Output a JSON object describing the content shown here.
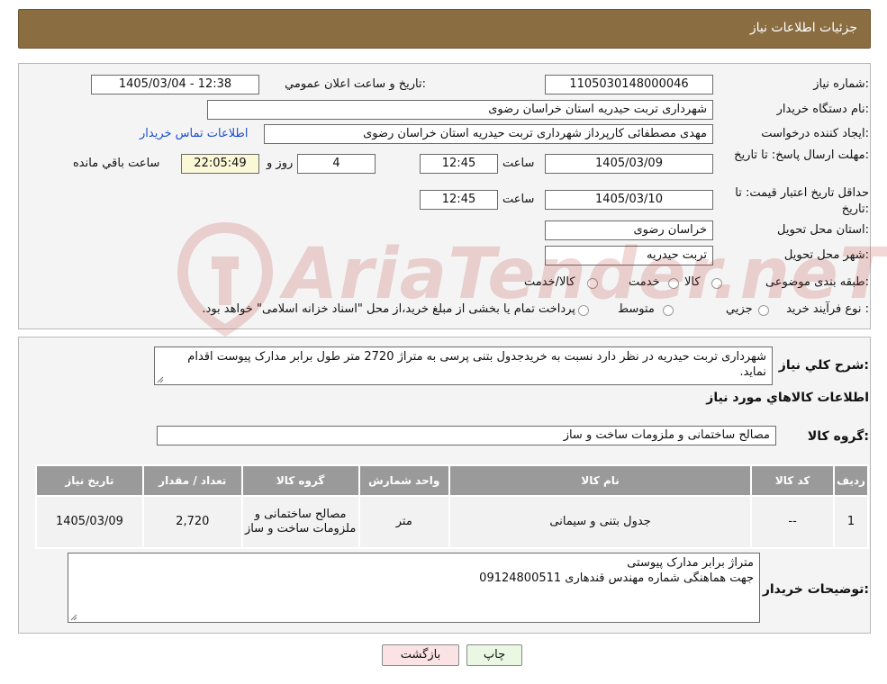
{
  "header": {
    "title": "جزئیات اطلاعات نیاز"
  },
  "details": {
    "need_number_label": "شماره نیاز:",
    "need_number": "1105030148000046",
    "announce_label": "تاریخ و ساعت اعلان عمومي:",
    "announce_value": "1405/03/04 - 12:38",
    "buyer_org_label": "نام دستگاه خريدار:",
    "buyer_org": "شهرداری تربت حیدریه استان خراسان رضوی",
    "creator_label": "ايجاد کننده درخواست:",
    "creator": "مهدی مصطفائی کارپرداز شهرداری تربت حیدریه استان خراسان رضوی",
    "contact_link": "اطلاعات تماس خريدار",
    "deadline_label": "مهلت ارسال پاسخ: تا تاریخ:",
    "deadline_date": "1405/03/09",
    "time_label": "ساعت",
    "deadline_time": "12:45",
    "days_value": "4",
    "days_label": "روز و",
    "remaining_time": "22:05:49",
    "remaining_label": "ساعت باقي مانده",
    "validity_label": "حداقل تاريخ اعتبار قيمت: تا تاریخ:",
    "validity_date": "1405/03/10",
    "validity_time": "12:45",
    "province_label": "استان محل تحويل:",
    "province": "خراسان رضوی",
    "city_label": "شهر محل تحويل:",
    "city": "تربت حیدریه",
    "category_label": "طبقه بندی موضوعی:",
    "category_options": [
      "کالا",
      "خدمت",
      "کالا/خدمت"
    ],
    "process_label": "نوع فرآيند خريد :",
    "process_options": [
      "جزيي",
      "متوسط"
    ],
    "process_note": "پرداخت تمام یا بخشی از مبلغ خرید،از محل \"اسناد خزانه اسلامی\" خواهد بود."
  },
  "summary": {
    "label": "شرح كلي نياز:",
    "text": "شهرداری تربت حیدریه در نظر دارد نسبت به خریدجدول بتنی پرسی به متراژ 2720 متر طول برابر مدارک پیوست اقدام نماید.",
    "goods_info_title": "اطلاعات کالاهاي مورد نياز",
    "group_label": "گروه کالا:",
    "group_value": "مصالح ساختمانی و ملزومات ساخت و ساز"
  },
  "table": {
    "headers": [
      "رديف",
      "کد کالا",
      "نام کالا",
      "واحد شمارش",
      "گروه کالا",
      "تعداد / مقدار",
      "تاريخ نياز"
    ],
    "rows": [
      [
        "1",
        "--",
        "جدول بتنی و سیمانی",
        "متر",
        "مصالح ساختمانی و ملزومات ساخت و ساز",
        "2,720",
        "1405/03/09"
      ]
    ]
  },
  "notes": {
    "label": "توضيحات خريدار:",
    "line1": "متراژ برابر مدارک پیوستی",
    "line2": "جهت هماهنگی شماره مهندس قندهاری 09124800511"
  },
  "buttons": {
    "print": "چاپ",
    "back": "بازگشت"
  },
  "watermark": {
    "text": "AriaTender.neT"
  },
  "colors": {
    "header": "#8b6d42",
    "link": "#1a4fd0",
    "back_button": "#fbe3e3",
    "print_button": "#e9f7e3"
  }
}
